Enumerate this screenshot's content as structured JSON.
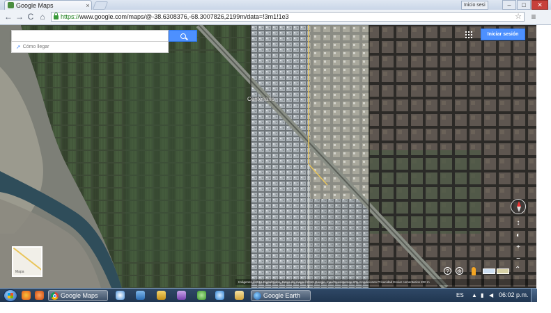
{
  "browser": {
    "tab_title": "Google Maps",
    "tab_close": "×",
    "user_chip": "Inicio sesi",
    "window_controls": {
      "minimize": "–",
      "maximize": "□",
      "close": "✕"
    },
    "nav": {
      "back": "←",
      "forward": "→",
      "reload": "C",
      "home": "⌂"
    },
    "url_scheme": "https://",
    "url_rest": "www.google.com/maps/@-38.6308376,-68.3007826,2199m/data=!3m1!1e3",
    "star": "☆",
    "menu": "≡"
  },
  "map": {
    "search_placeholder": "",
    "directions_label": "Cómo llegar",
    "signin_label": "Iniciar sesión",
    "place_label": "Centenario",
    "minimap_label": "Mapa",
    "controls": {
      "plus": "+",
      "minus": "−",
      "tilt": "↕",
      "rotate": "◐",
      "help": "?",
      "settings": "⚙",
      "expand": "⌃"
    },
    "attribution": "Imágenes ©2015 DigitalGlobe, Datos del mapa ©2015 Google, Inav/Geosistemas SRL    Condiciones    Privacidad    Enviar comentarios    200 m"
  },
  "taskbar": {
    "tasks": [
      {
        "label": "Google Maps",
        "icon": "chrome-icon"
      },
      {
        "label": "Google Earth",
        "icon": "earth-icon"
      }
    ],
    "pinned": [
      "ie-icon",
      "firefox-icon",
      "explorer-icon",
      "media-icon",
      "paint-icon",
      "refresh-icon",
      "ie-icon-2",
      "folder-icon"
    ],
    "language": "ES",
    "clock": "06:02 p.m."
  },
  "colors": {
    "accent": "#4d90fe",
    "road": "#e9c55a",
    "taskbar": "#203650"
  }
}
